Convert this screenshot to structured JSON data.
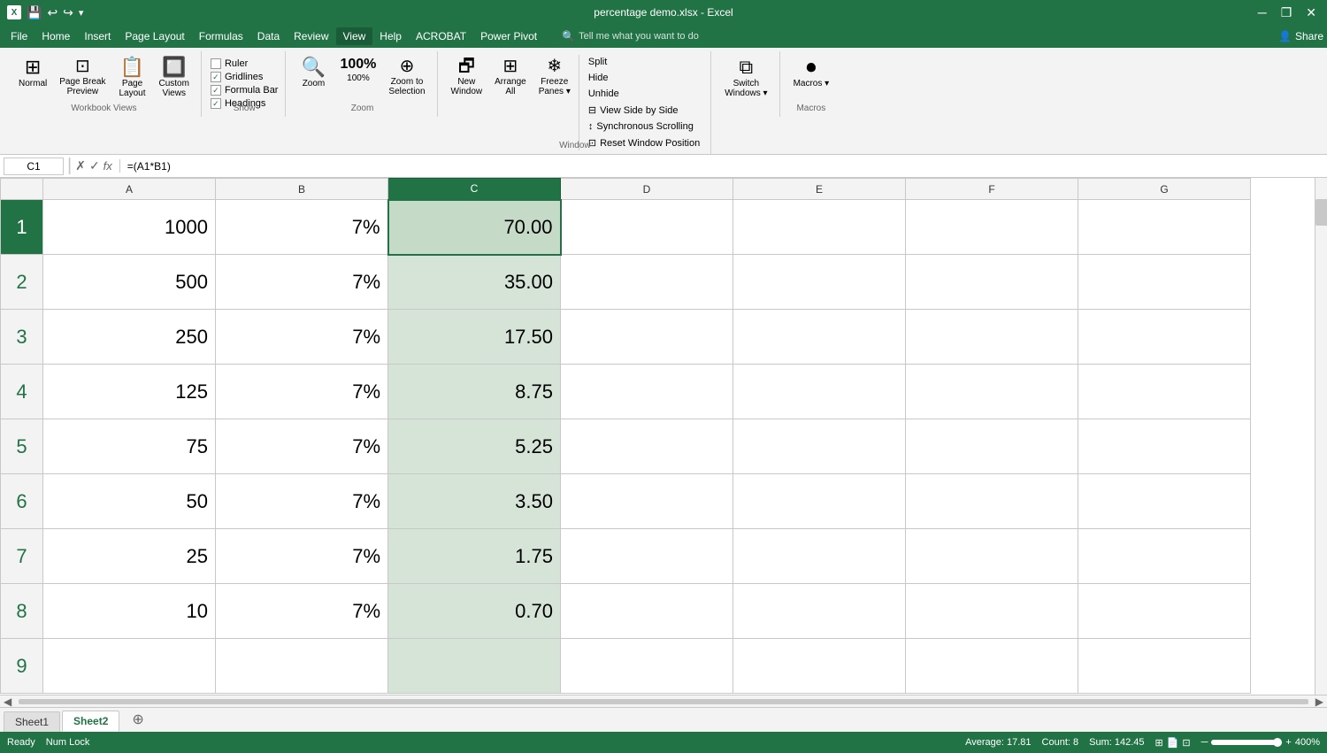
{
  "titleBar": {
    "quickAccess": [
      "save",
      "undo",
      "redo",
      "customize"
    ],
    "title": "percentage demo.xlsx - Excel",
    "windowButtons": [
      "minimize",
      "restore",
      "close"
    ]
  },
  "menuBar": {
    "items": [
      "File",
      "Home",
      "Insert",
      "Page Layout",
      "Formulas",
      "Data",
      "Review",
      "View",
      "Help",
      "ACROBAT",
      "Power Pivot"
    ],
    "activeItem": "View",
    "searchPlaceholder": "Tell me what you want to do",
    "share": "Share"
  },
  "ribbon": {
    "groups": [
      {
        "label": "Workbook Views",
        "buttons": [
          {
            "id": "normal",
            "label": "Normal",
            "icon": "⊞"
          },
          {
            "id": "page-break-preview",
            "label": "Page Break\nPreview",
            "icon": "⊡"
          },
          {
            "id": "page-layout",
            "label": "Page\nLayout",
            "icon": "📄"
          },
          {
            "id": "custom-views",
            "label": "Custom\nViews",
            "icon": "🔲"
          }
        ]
      },
      {
        "label": "Show",
        "checkboxes": [
          {
            "id": "ruler",
            "label": "Ruler",
            "checked": false
          },
          {
            "id": "gridlines",
            "label": "Gridlines",
            "checked": true
          },
          {
            "id": "formula-bar",
            "label": "Formula Bar",
            "checked": true
          },
          {
            "id": "headings",
            "label": "Headings",
            "checked": true
          }
        ]
      },
      {
        "label": "Zoom",
        "buttons": [
          {
            "id": "zoom",
            "label": "Zoom",
            "icon": "🔍"
          },
          {
            "id": "zoom-100",
            "label": "100%",
            "icon": "1:1"
          },
          {
            "id": "zoom-to-selection",
            "label": "Zoom to\nSelection",
            "icon": "⊕"
          }
        ]
      },
      {
        "label": "Window",
        "items": [
          {
            "id": "new-window",
            "label": "New\nWindow",
            "icon": "🗗"
          },
          {
            "id": "arrange-all",
            "label": "Arrange\nAll",
            "icon": "⊞"
          },
          {
            "id": "freeze-panes",
            "label": "Freeze\nPanes",
            "icon": "❄"
          }
        ],
        "smallItems": [
          {
            "id": "split",
            "label": "Split"
          },
          {
            "id": "hide",
            "label": "Hide"
          },
          {
            "id": "unhide",
            "label": "Unhide"
          },
          {
            "id": "view-side-by-side",
            "label": "View Side by Side"
          },
          {
            "id": "sync-scrolling",
            "label": "Synchronous Scrolling"
          },
          {
            "id": "reset-position",
            "label": "Reset Window Position"
          }
        ]
      },
      {
        "label": "",
        "buttons": [
          {
            "id": "switch-windows",
            "label": "Switch\nWindows",
            "icon": "⧉"
          }
        ]
      },
      {
        "label": "Macros",
        "buttons": [
          {
            "id": "macros",
            "label": "Macros",
            "icon": "⏺"
          }
        ]
      }
    ]
  },
  "formulaBar": {
    "nameBox": "C1",
    "formula": "=(A1*B1)",
    "icons": [
      "✗",
      "✓",
      "fx"
    ]
  },
  "grid": {
    "columns": [
      "A",
      "B",
      "C",
      "D",
      "E",
      "F",
      "G"
    ],
    "selectedColumn": "C",
    "rows": [
      {
        "num": 1,
        "a": "1000",
        "b": "7%",
        "c": "70.00",
        "selected": true
      },
      {
        "num": 2,
        "a": "500",
        "b": "7%",
        "c": "35.00"
      },
      {
        "num": 3,
        "a": "250",
        "b": "7%",
        "c": "17.50"
      },
      {
        "num": 4,
        "a": "125",
        "b": "7%",
        "c": "8.75"
      },
      {
        "num": 5,
        "a": "75",
        "b": "7%",
        "c": "5.25"
      },
      {
        "num": 6,
        "a": "50",
        "b": "7%",
        "c": "3.50"
      },
      {
        "num": 7,
        "a": "25",
        "b": "7%",
        "c": "1.75"
      },
      {
        "num": 8,
        "a": "10",
        "b": "7%",
        "c": "0.70"
      },
      {
        "num": 9,
        "a": "",
        "b": "",
        "c": ""
      }
    ]
  },
  "sheetTabs": {
    "tabs": [
      "Sheet1",
      "Sheet2"
    ],
    "activeTab": "Sheet2"
  },
  "statusBar": {
    "mode": "Ready",
    "capsLock": "Num Lock",
    "stats": {
      "average": "Average: 17.81",
      "count": "Count: 8",
      "sum": "Sum: 142.45"
    },
    "zoom": "400%",
    "viewIcons": [
      "normal-view",
      "page-layout-view",
      "page-break-view"
    ]
  }
}
